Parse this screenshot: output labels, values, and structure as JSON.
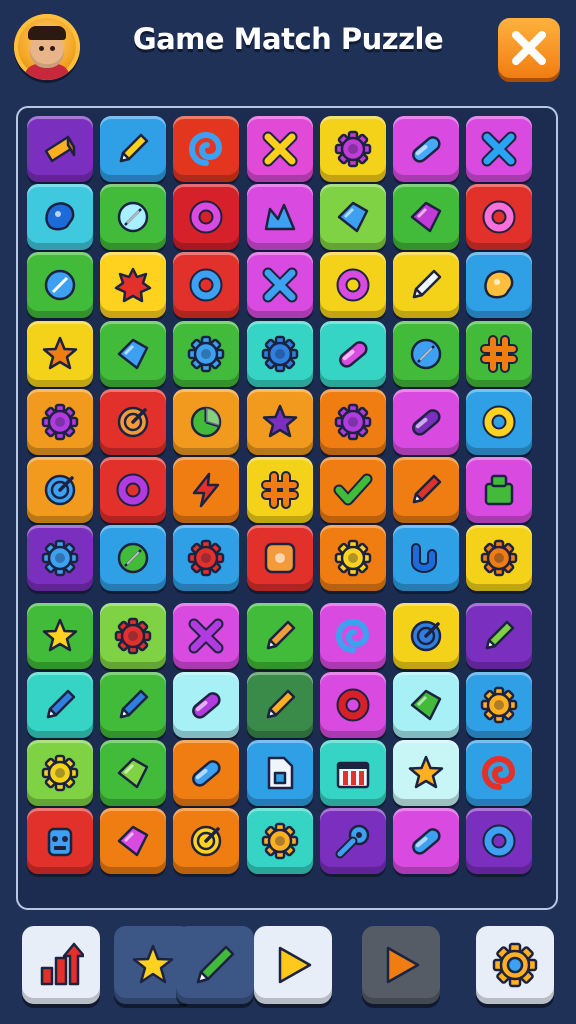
{
  "header": {
    "title": "Game Match Puzzle",
    "avatar_icon": "player-avatar",
    "close_icon": "close-icon"
  },
  "board": {
    "columns": 7,
    "rows": 11,
    "tiles": [
      [
        {
          "c": "#7b2fbe",
          "i": "wedge",
          "g": "#ffb020"
        },
        {
          "c": "#2f9fe6",
          "i": "pencil",
          "g": "#ffd21f"
        },
        {
          "c": "#e2371e",
          "i": "swirl",
          "g": "#3da0f0"
        },
        {
          "c": "#e04ad6",
          "i": "cross",
          "g": "#ffcf1d"
        },
        {
          "c": "#f5d21a",
          "i": "gear",
          "g": "#c13bd6"
        },
        {
          "c": "#d94be0",
          "i": "pill",
          "g": "#46a9ff"
        },
        {
          "c": "#d94be0",
          "i": "cross",
          "g": "#2aa3f2"
        }
      ],
      [
        {
          "c": "#3fc9df",
          "i": "blob",
          "g": "#1d6bd8"
        },
        {
          "c": "#43bb3a",
          "i": "leaf",
          "g": "#a8f0ff"
        },
        {
          "c": "#d6202a",
          "i": "ring",
          "g": "#d94be0"
        },
        {
          "c": "#d94be0",
          "i": "crown",
          "g": "#3da0f0"
        },
        {
          "c": "#7fd244",
          "i": "chip",
          "g": "#3da0f0"
        },
        {
          "c": "#43bb3a",
          "i": "chip",
          "g": "#c13bd6"
        },
        {
          "c": "#e2302b",
          "i": "ring",
          "g": "#ff6fd9"
        }
      ],
      [
        {
          "c": "#43bb3a",
          "i": "disc",
          "g": "#3da0f0"
        },
        {
          "c": "#ffd21f",
          "i": "burst",
          "g": "#e2302b"
        },
        {
          "c": "#e2302b",
          "i": "ring",
          "g": "#3da0f0"
        },
        {
          "c": "#d94be0",
          "i": "cross",
          "g": "#3da0f0"
        },
        {
          "c": "#f5d21a",
          "i": "ring",
          "g": "#d94be0"
        },
        {
          "c": "#f5d21a",
          "i": "pencil",
          "g": "#f0f6ff"
        },
        {
          "c": "#2f9fe6",
          "i": "blob",
          "g": "#ffbf3d"
        }
      ],
      [
        {
          "c": "#f5d21a",
          "i": "star",
          "g": "#f07d12"
        },
        {
          "c": "#43bb3a",
          "i": "chip",
          "g": "#3da0f0"
        },
        {
          "c": "#43bb3a",
          "i": "gear",
          "g": "#3da0f0"
        },
        {
          "c": "#36d4c5",
          "i": "gear",
          "g": "#2f7fe0"
        },
        {
          "c": "#36d4c5",
          "i": "pill",
          "g": "#d94be0"
        },
        {
          "c": "#43bb3a",
          "i": "leaf",
          "g": "#3da0f0"
        },
        {
          "c": "#43bb3a",
          "i": "hash",
          "g": "#f07d12"
        }
      ],
      [
        {
          "c": "#f29a1d",
          "i": "gear",
          "g": "#b23be0"
        },
        {
          "c": "#e2302b",
          "i": "dial",
          "g": "#f59a3c"
        },
        {
          "c": "#f29a1d",
          "i": "pie",
          "g": "#43bb3a"
        },
        {
          "c": "#f29a1d",
          "i": "star",
          "g": "#7b2fbe"
        },
        {
          "c": "#f07d12",
          "i": "gear",
          "g": "#b23be0"
        },
        {
          "c": "#d94be0",
          "i": "pill",
          "g": "#7b2fbe"
        },
        {
          "c": "#2f9fe6",
          "i": "ring",
          "g": "#ffd21f"
        }
      ],
      [
        {
          "c": "#f29a1d",
          "i": "dial",
          "g": "#3da0f0"
        },
        {
          "c": "#e2302b",
          "i": "ring",
          "g": "#b23be0"
        },
        {
          "c": "#f07d12",
          "i": "bolt",
          "g": "#e2302b"
        },
        {
          "c": "#f5d21a",
          "i": "hash",
          "g": "#f07d12"
        },
        {
          "c": "#f07d12",
          "i": "check",
          "g": "#43bb3a"
        },
        {
          "c": "#f07d12",
          "i": "pencil",
          "g": "#e2302b"
        },
        {
          "c": "#d94be0",
          "i": "box",
          "g": "#43bb3a"
        }
      ],
      [
        {
          "c": "#7b2fbe",
          "i": "gear",
          "g": "#3da0f0"
        },
        {
          "c": "#2f9fe6",
          "i": "leaf",
          "g": "#43bb3a"
        },
        {
          "c": "#2f9fe6",
          "i": "gear",
          "g": "#e2302b"
        },
        {
          "c": "#e2302b",
          "i": "square",
          "g": "#f59a3c"
        },
        {
          "c": "#f07d12",
          "i": "gear",
          "g": "#ffd21f"
        },
        {
          "c": "#2f9fe6",
          "i": "hook",
          "g": "#1d6bd8"
        },
        {
          "c": "#f5d21a",
          "i": "gear",
          "g": "#f07d12"
        }
      ],
      [
        {
          "c": "#43bb3a",
          "i": "star",
          "g": "#ffd21f"
        },
        {
          "c": "#7fd244",
          "i": "gear",
          "g": "#e2302b"
        },
        {
          "c": "#d94be0",
          "i": "cross",
          "g": "#b23be0"
        },
        {
          "c": "#43bb3a",
          "i": "pencil",
          "g": "#f0a033"
        },
        {
          "c": "#d94be0",
          "i": "swirl",
          "g": "#3da0f0"
        },
        {
          "c": "#f5d21a",
          "i": "dial",
          "g": "#2f7fe0"
        },
        {
          "c": "#7b2fbe",
          "i": "pencil",
          "g": "#7fd244"
        }
      ],
      [
        {
          "c": "#36d4c5",
          "i": "pencil",
          "g": "#2f7fe0"
        },
        {
          "c": "#43bb3a",
          "i": "pencil",
          "g": "#2f7fe0"
        },
        {
          "c": "#a7f0f5",
          "i": "pill",
          "g": "#b23be0"
        },
        {
          "c": "#3a8a4a",
          "i": "pencil",
          "g": "#ffb020"
        },
        {
          "c": "#d94be0",
          "i": "ring",
          "g": "#d6202a"
        },
        {
          "c": "#a7f0f5",
          "i": "chip",
          "g": "#43bb3a"
        },
        {
          "c": "#2f9fe6",
          "i": "gear",
          "g": "#ffb020"
        }
      ],
      [
        {
          "c": "#7fd244",
          "i": "gear",
          "g": "#f5d21a"
        },
        {
          "c": "#43bb3a",
          "i": "chip",
          "g": "#7fd244"
        },
        {
          "c": "#f07d12",
          "i": "pill",
          "g": "#3da0f0"
        },
        {
          "c": "#2f9fe6",
          "i": "doc",
          "g": "#f0f6ff"
        },
        {
          "c": "#36d4c5",
          "i": "shop",
          "g": "#e2302b"
        },
        {
          "c": "#c8f6f6",
          "i": "star",
          "g": "#ffb020"
        },
        {
          "c": "#2f9fe6",
          "i": "swirl",
          "g": "#e2302b"
        }
      ],
      [
        {
          "c": "#e2302b",
          "i": "robot",
          "g": "#3da0f0"
        },
        {
          "c": "#f07d12",
          "i": "chip",
          "g": "#d94be0"
        },
        {
          "c": "#f07d12",
          "i": "dial",
          "g": "#ffd21f"
        },
        {
          "c": "#36d4c5",
          "i": "gear",
          "g": "#ffb020"
        },
        {
          "c": "#7b2fbe",
          "i": "key",
          "g": "#3da0f0"
        },
        {
          "c": "#d94be0",
          "i": "pill",
          "g": "#3da0f0"
        },
        {
          "c": "#7b2fbe",
          "i": "ring",
          "g": "#3da0f0"
        }
      ]
    ]
  },
  "toolbar": {
    "buttons": [
      {
        "name": "chart-up-button",
        "icon": "chart-up-icon",
        "bg": "#e8eef8",
        "fg": "#e2302b"
      },
      {
        "name": "star-powerup-button",
        "icon": "star-icon",
        "bg": "#3c5686",
        "fg": "#ffd21f"
      },
      {
        "name": "pencil-powerup-button",
        "icon": "pencil-icon",
        "bg": "#3c5686",
        "fg": "#43bb3a"
      },
      {
        "name": "play-button",
        "icon": "play-icon",
        "bg": "#e8eef8",
        "fg": "#ffc81c"
      },
      {
        "name": "fast-forward-button",
        "icon": "play-orange-icon",
        "bg": "#555c66",
        "fg": "#f07d12"
      },
      {
        "name": "settings-button",
        "icon": "gear-icon",
        "bg": "#e8eef8",
        "fg": "#ffb020"
      }
    ]
  }
}
